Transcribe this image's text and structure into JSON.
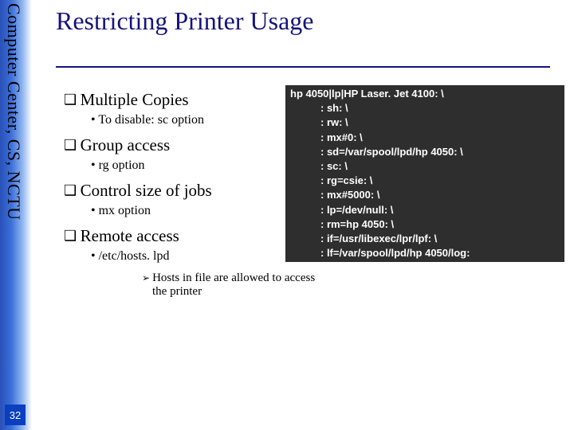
{
  "sidebar": {
    "org_text": "Computer Center, CS, NCTU",
    "page_number": "32"
  },
  "title": "Restricting Printer Usage",
  "bullets": {
    "b1": "Multiple Copies",
    "b1a": "To disable: sc  option",
    "b2": "Group access",
    "b2a": "rg option",
    "b3": "Control size of jobs",
    "b3a": "mx option",
    "b4": "Remote access",
    "b4a": "/etc/hosts. lpd",
    "b4b": "Hosts in file are allowed to access the printer"
  },
  "code": {
    "l1": "hp 4050|lp|HP Laser. Jet 4100: \\",
    "l2": ": sh: \\",
    "l3": ": rw: \\",
    "l4": ": mx#0: \\",
    "l5": ": sd=/var/spool/lpd/hp 4050: \\",
    "l6": ": sc: \\",
    "l7": ": rg=csie: \\",
    "l8": ": mx#5000: \\",
    "l9": ": lp=/dev/null: \\",
    "l10": ": rm=hp 4050: \\",
    "l11": ": if=/usr/libexec/lpr/lpf: \\",
    "l12": ": lf=/var/spool/lpd/hp 4050/log:"
  }
}
